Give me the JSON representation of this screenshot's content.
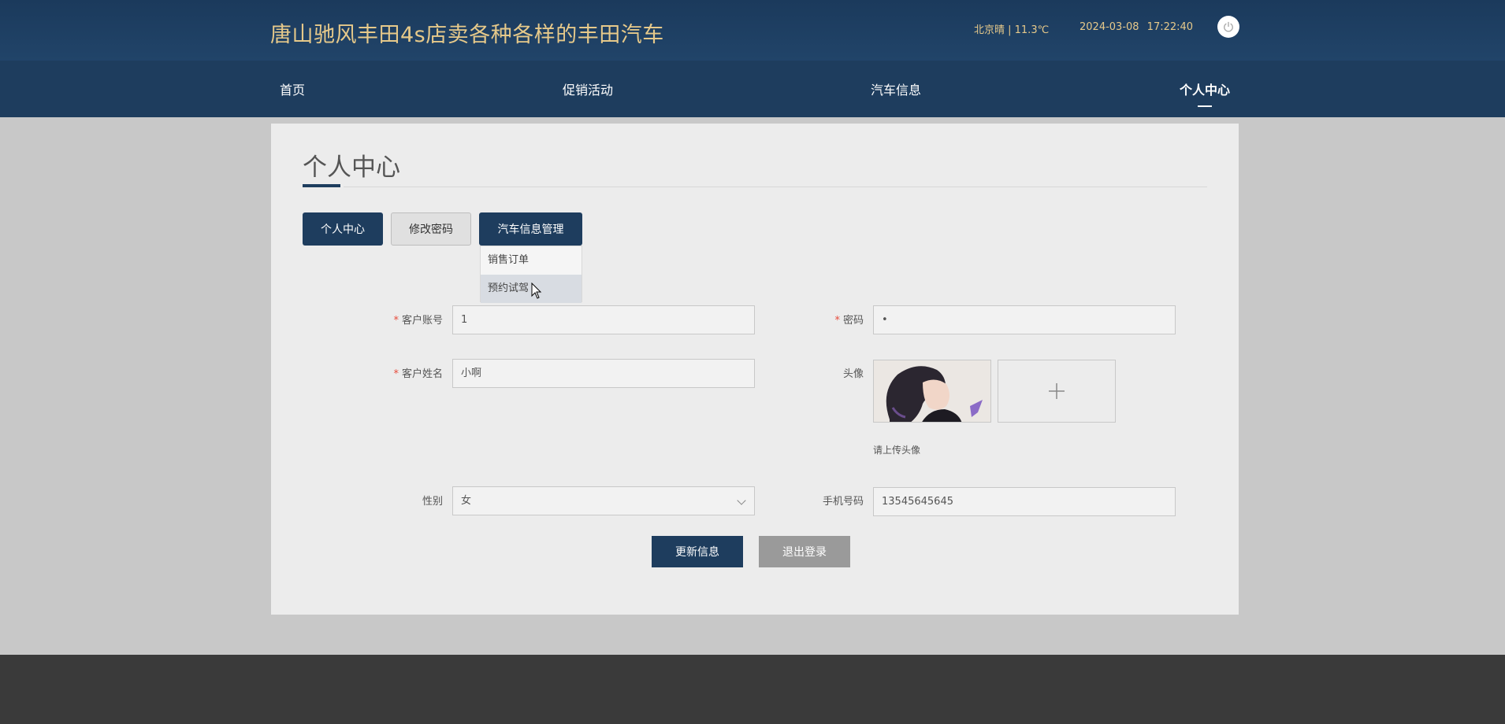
{
  "header": {
    "site_title": "唐山驰风丰田4s店卖各种各样的丰田汽车",
    "weather": "北京晴 | 11.3℃",
    "datetime": "2024-03-08  17:22:40",
    "power_icon": "power-icon"
  },
  "nav": {
    "items": [
      {
        "label": "首页"
      },
      {
        "label": "促销活动"
      },
      {
        "label": "汽车信息"
      },
      {
        "label": "个人中心",
        "active": true
      }
    ]
  },
  "main": {
    "title": "个人中心",
    "tabs": {
      "profile": "个人中心",
      "change_password": "修改密码",
      "car_manage": "汽车信息管理"
    },
    "dropdown": {
      "items": [
        "销售订单",
        "预约试驾"
      ],
      "hovered": "预约试驾"
    },
    "form": {
      "account_label": "客户账号",
      "account_value": "1",
      "password_label": "密码",
      "password_value": "•",
      "name_label": "客户姓名",
      "name_value": "小啊",
      "avatar_label": "头像",
      "avatar_hint": "请上传头像",
      "upload_icon": "plus-icon",
      "gender_label": "性别",
      "gender_value": "女",
      "phone_label": "手机号码",
      "phone_value": "13545645645"
    },
    "buttons": {
      "update": "更新信息",
      "logout": "退出登录"
    }
  },
  "colors": {
    "header_bg": "#1e3d5e",
    "title_gold": "#e6c98a",
    "primary": "#1e3d5e",
    "secondary_btn": "#9a9a9a",
    "footer_bg": "#3a3a3a"
  }
}
